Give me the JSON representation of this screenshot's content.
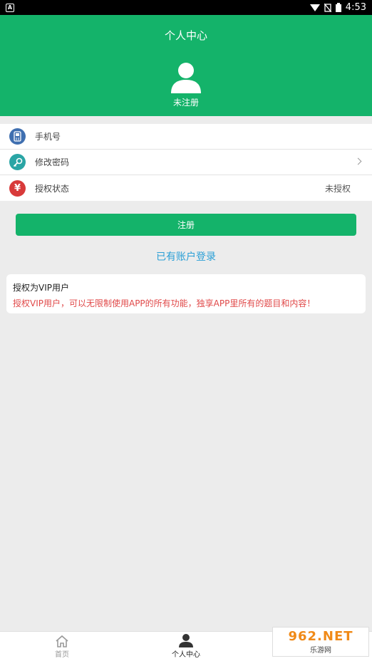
{
  "status_bar": {
    "time": "4:53",
    "app_badge": "A"
  },
  "header": {
    "title": "个人中心",
    "user_status": "未注册"
  },
  "menu": [
    {
      "label": "手机号",
      "value": "",
      "icon": "phone-icon",
      "icon_color": "#3f6fb0"
    },
    {
      "label": "修改密码",
      "value": "",
      "icon": "key-icon",
      "icon_color": "#2aa5a5"
    },
    {
      "label": "授权状态",
      "value": "未授权",
      "icon": "yen-icon",
      "icon_color": "#d83a3a"
    }
  ],
  "register_button": "注册",
  "login_link": "已有账户登录",
  "vip_card": {
    "title": "授权为VIP用户",
    "description": "授权VIP用户，可以无限制使用APP的所有功能，独享APP里所有的题目和内容！"
  },
  "tabbar": {
    "home": "首页",
    "profile": "个人中心"
  },
  "watermark": {
    "main": "962.NET",
    "sub": "乐游网"
  },
  "colors": {
    "primary": "#14b36a",
    "link": "#2a9fd6",
    "warning_text": "#e04848"
  }
}
